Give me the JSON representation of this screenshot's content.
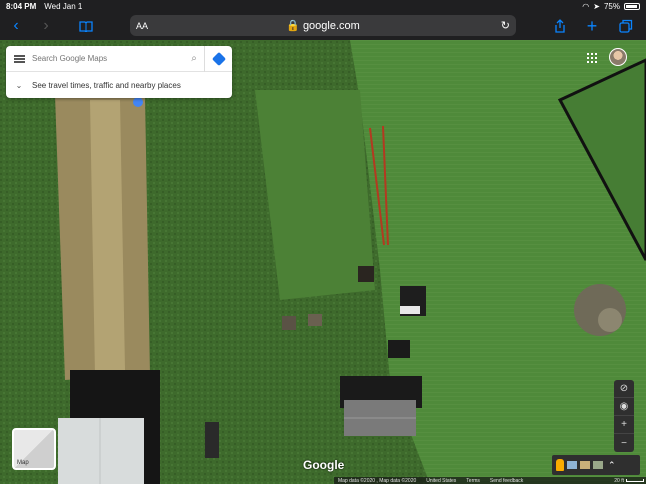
{
  "status_bar": {
    "time": "8:04 PM",
    "date": "Wed Jan 1",
    "battery": "75%"
  },
  "browser": {
    "aa_label": "AA",
    "url": "google.com",
    "back_icon": "chevron-left-icon",
    "forward_icon": "chevron-right-icon",
    "bookmarks_icon": "book-icon",
    "share_icon": "share-icon",
    "new_tab_icon": "plus-icon",
    "tabs_icon": "tabs-icon",
    "accent_color": "#0a84ff"
  },
  "search": {
    "placeholder": "Search Google Maps",
    "travel_text": "See travel times, traffic and nearby places"
  },
  "map": {
    "view": "satellite",
    "layer_label": "Map",
    "logo": "Google",
    "footer": {
      "attribution": "Map data ©2020 , Map data ©2020",
      "region": "United States",
      "terms": "Terms",
      "feedback": "Send feedback",
      "scale": "20 ft"
    }
  }
}
